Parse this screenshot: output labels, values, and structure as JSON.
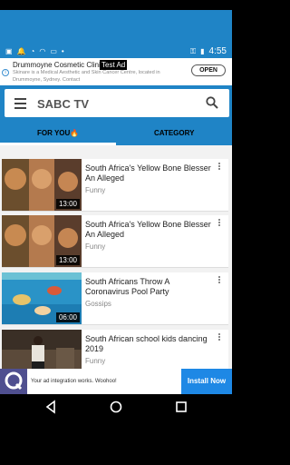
{
  "status_bar": {
    "time": "4:55",
    "left_icons": [
      "image-icon",
      "notification-icon",
      "sync-icon",
      "cast-icon",
      "screen-icon",
      "more-icon"
    ],
    "right_icons": [
      "vpn-key-icon",
      "battery-icon"
    ]
  },
  "ad": {
    "title": "Drummoyne Cosmetic Clinic",
    "tag": "Test Ad",
    "description": "Skinare is a Medical Aesthetic and Skin Cancer Centre, located in Drummoyne, Sydney. Contact",
    "cta": "OPEN"
  },
  "app": {
    "title": "SABC TV",
    "accent": "#1f84c6"
  },
  "tabs": [
    {
      "label": "FOR YOU🔥",
      "active": true
    },
    {
      "label": "CATEGORY",
      "active": false
    }
  ],
  "videos": [
    {
      "title": "South Africa's Yellow Bone Blesser An Alleged",
      "category": "Funny",
      "duration": "13:00"
    },
    {
      "title": "South Africa's Yellow Bone Blesser An Alleged",
      "category": "Funny",
      "duration": "13:00"
    },
    {
      "title": "South Africans Throw A Coronavirus Pool Party",
      "category": "Gossips",
      "duration": "06:00"
    },
    {
      "title": "South African school kids dancing 2019",
      "category": "Funny",
      "duration": ""
    }
  ],
  "bottom_ad": {
    "text": "Your ad integration works. Woohoo!",
    "cta": "Install Now"
  }
}
